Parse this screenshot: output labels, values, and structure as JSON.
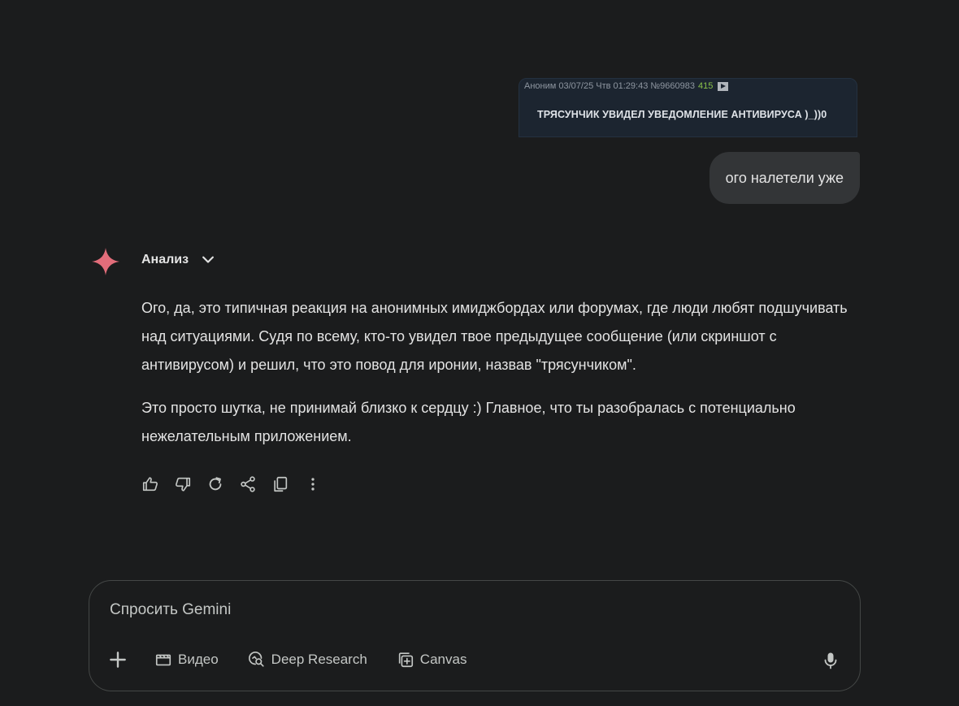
{
  "attachment": {
    "meta": "Аноним 03/07/25 Чтв 01:29:43 №9660983",
    "votes": "415",
    "text": "ТРЯСУНЧИК УВИДЕЛ УВЕДОМЛЕНИЕ АНТИВИРУСА )_))0"
  },
  "user_message": "ого налетели уже",
  "model": {
    "analysis_label": "Анализ",
    "paragraphs": [
      "Ого, да, это типичная реакция на анонимных имиджбордах или форумах, где люди любят подшучивать над ситуациями. Судя по всему, кто-то увидел твое предыдущее сообщение (или скриншот с антивирусом) и решил, что это повод для иронии, назвав \"трясунчиком\".",
      "Это просто шутка, не принимай близко к сердцу :) Главное, что ты разобралась с потенциально нежелательным приложением."
    ],
    "actions": [
      "thumbs-up-icon",
      "thumbs-down-icon",
      "regenerate-icon",
      "share-icon",
      "copy-icon",
      "more-vert-icon"
    ]
  },
  "composer": {
    "placeholder": "Спросить Gemini",
    "tools": [
      {
        "label": "Видео",
        "icon": "video-icon"
      },
      {
        "label": "Deep Research",
        "icon": "deep-research-icon"
      },
      {
        "label": "Canvas",
        "icon": "canvas-icon"
      }
    ]
  },
  "colors": {
    "background": "#1b1c1d",
    "bubble": "#333537",
    "gemini_star": "#e26d7a"
  }
}
